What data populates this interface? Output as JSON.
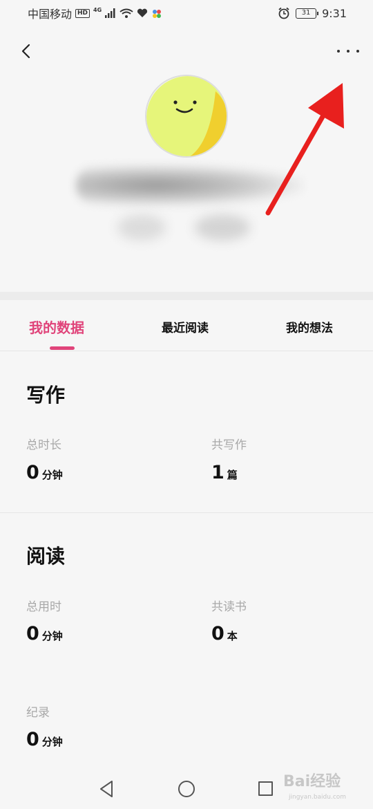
{
  "status_bar": {
    "carrier": "中国移动",
    "hd": "HD",
    "network": "4G",
    "battery": "31",
    "time": "9:31"
  },
  "profile": {
    "avatar": "smiley-face-avatar",
    "name_blurred": true
  },
  "tabs": [
    {
      "label": "我的数据",
      "active": true
    },
    {
      "label": "最近阅读",
      "active": false
    },
    {
      "label": "我的想法",
      "active": false
    }
  ],
  "writing": {
    "title": "写作",
    "total_time_label": "总时长",
    "total_time_value": "0",
    "total_time_unit": "分钟",
    "count_label": "共写作",
    "count_value": "1",
    "count_unit": "篇"
  },
  "reading": {
    "title": "阅读",
    "total_time_label": "总用时",
    "total_time_value": "0",
    "total_time_unit": "分钟",
    "books_label": "共读书",
    "books_value": "0",
    "books_unit": "本",
    "record_label": "纪录",
    "record_value": "0",
    "record_unit": "分钟"
  },
  "watermark": {
    "brand": "Bai经验",
    "url": "jingyan.baidu.com"
  },
  "colors": {
    "accent": "#e0447a",
    "annotation_arrow": "#e8201e",
    "avatar_fill": "#e6f57a"
  }
}
